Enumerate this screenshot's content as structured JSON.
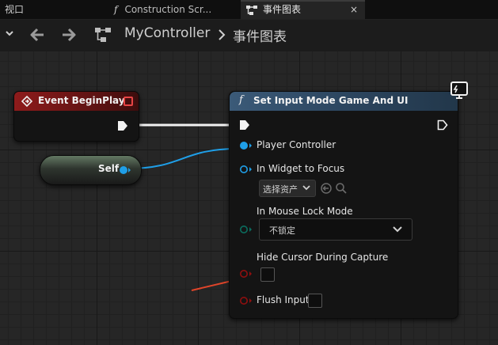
{
  "tabs": {
    "viewport": "视口",
    "construction": "Construction Scr...",
    "construction_icon": "function-icon",
    "event_graph": "事件图表",
    "event_graph_close": "×"
  },
  "toolbar": {
    "breadcrumb": [
      "MyController",
      "事件图表"
    ]
  },
  "nodes": {
    "event_begin_play": {
      "title": "Event BeginPlay",
      "header_color": "#8e1b1b"
    },
    "self": {
      "label": "Self"
    },
    "set_input_mode": {
      "title": "Set Input Mode Game And UI",
      "header_color": "#3b5a78",
      "pins": {
        "player_controller": "Player Controller",
        "in_widget_to_focus": "In Widget to Focus",
        "widget_asset_placeholder": "选择资产",
        "in_mouse_lock_mode": "In Mouse Lock Mode",
        "mouse_lock_value": "不锁定",
        "hide_cursor": "Hide Cursor During Capture",
        "flush_input": "Flush Input"
      },
      "hide_cursor_checked": false,
      "flush_input_checked": false
    }
  },
  "colors": {
    "object_pin": "#1f9fe8",
    "enum_pin": "#0b6d5f",
    "bool_pin": "#8e0f0f",
    "annotation_arrow": "#e0452a"
  }
}
